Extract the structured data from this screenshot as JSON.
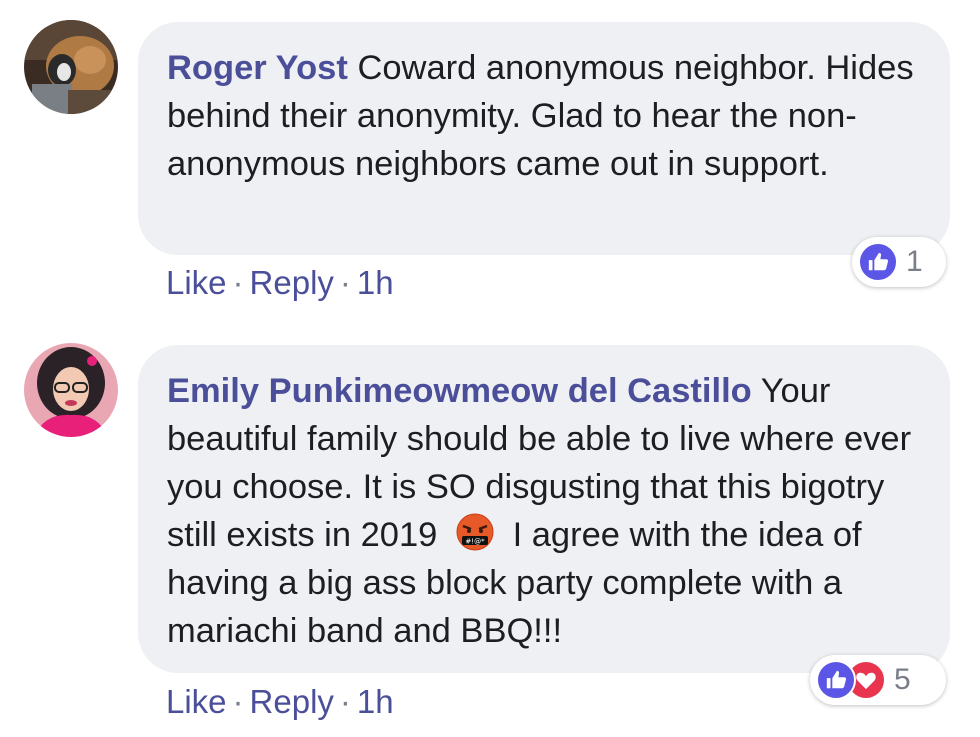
{
  "comments": [
    {
      "author": "Roger Yost",
      "text": "Coward anonymous neighbor. Hides behind their anonymity. Glad to hear the non-anonymous neighbors came out in support.",
      "actions": {
        "like": "Like",
        "reply": "Reply",
        "time": "1h",
        "separator": "·"
      },
      "reactions": {
        "icons": [
          "like-icon"
        ],
        "count": "1"
      }
    },
    {
      "author": "Emily Punkimeowmeow del Castillo",
      "text_before_emoji": "Your beautiful family should be able to live where ever you choose. It is SO disgusting that this bigotry still exists in 2019",
      "emoji": "angry-cursing-face-emoji",
      "text_after_emoji": "I agree with the idea of having a big ass block party complete with a mariachi band and BBQ!!!",
      "actions": {
        "like": "Like",
        "reply": "Reply",
        "time": "1h",
        "separator": "·"
      },
      "reactions": {
        "icons": [
          "like-icon",
          "love-icon"
        ],
        "count": "5"
      }
    }
  ],
  "colors": {
    "author": "#4b4f9a",
    "bubble": "#eff0f3",
    "like_reaction": "#5b56e6",
    "love_reaction": "#e8344f"
  }
}
